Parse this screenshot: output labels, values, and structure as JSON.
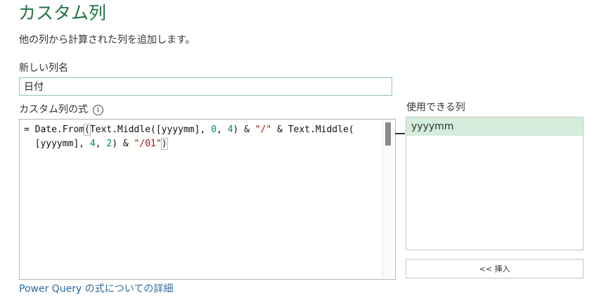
{
  "dialog": {
    "title": "カスタム列",
    "subtitle": "他の列から計算された列を追加します。"
  },
  "column_name": {
    "label": "新しい列名",
    "value": "日付"
  },
  "formula": {
    "label": "カスタム列の式",
    "info_icon": "info-icon",
    "line1": {
      "prefix": "= Date.From",
      "bracket": "(",
      "a": "Text.Middle([yyyymm], ",
      "n1": "0",
      "b": ", ",
      "n2": "4",
      "c": ") & ",
      "s1": "\"/\"",
      "d": " & Text.Middle("
    },
    "line2": {
      "indent": "  ",
      "a": "[yyyymm], ",
      "n1": "4",
      "b": ", ",
      "n2": "2",
      "c": ") & ",
      "s1": "\"/01\"",
      "bracket": ")"
    }
  },
  "available_columns": {
    "label": "使用できる列",
    "items": [
      "yyyymm"
    ]
  },
  "insert_button": {
    "label": "<< 挿入"
  },
  "help_link": {
    "label": "Power Query の式についての詳細"
  },
  "colors": {
    "title": "#217346",
    "selected_item": "#d4eddc",
    "link": "#2b6aa3",
    "number": "#098658",
    "string": "#a31515"
  }
}
